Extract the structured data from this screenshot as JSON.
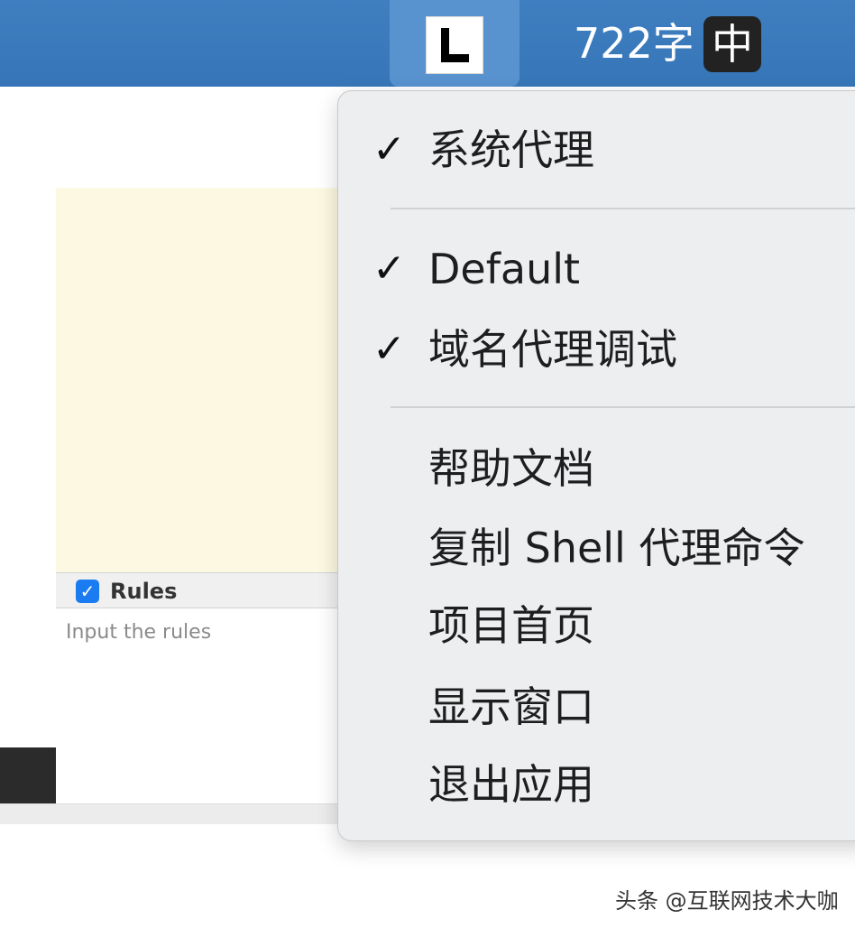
{
  "menubar": {
    "app_icon_letter": "L",
    "word_count": "722字",
    "ime_indicator": "中"
  },
  "background_window": {
    "rules_label": "Rules",
    "rules_checked": true,
    "rules_placeholder": "Input the rules"
  },
  "menu": {
    "items": [
      {
        "label": "系统代理",
        "checked": true,
        "check_glyph": "✓"
      },
      {
        "label": "Default",
        "checked": true,
        "check_glyph": "✓"
      },
      {
        "label": "域名代理调试",
        "checked": true,
        "check_glyph": "✓"
      },
      {
        "label": "帮助文档",
        "checked": false
      },
      {
        "label": "复制 Shell 代理命令",
        "checked": false
      },
      {
        "label": "项目首页",
        "checked": false
      },
      {
        "label": "显示窗口",
        "checked": false
      },
      {
        "label": "退出应用",
        "checked": false
      }
    ]
  },
  "watermark": "头条 @互联网技术大咖",
  "colors": {
    "menubar": "#3676b8",
    "editor_bg": "#fcf8e1",
    "checkbox": "#1b7cf2"
  }
}
